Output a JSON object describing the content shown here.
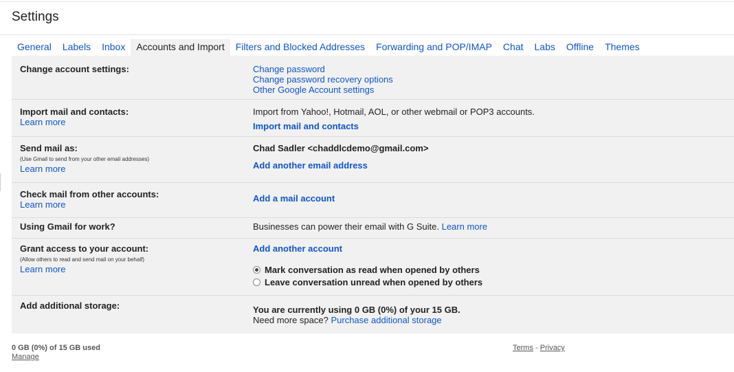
{
  "title": "Settings",
  "tabs": [
    {
      "label": "General"
    },
    {
      "label": "Labels"
    },
    {
      "label": "Inbox"
    },
    {
      "label": "Accounts and Import",
      "active": true
    },
    {
      "label": "Filters and Blocked Addresses"
    },
    {
      "label": "Forwarding and POP/IMAP"
    },
    {
      "label": "Chat"
    },
    {
      "label": "Labs"
    },
    {
      "label": "Offline"
    },
    {
      "label": "Themes"
    }
  ],
  "sections": {
    "change_account": {
      "label": "Change account settings:",
      "links": [
        "Change password",
        "Change password recovery options",
        "Other Google Account settings"
      ]
    },
    "import": {
      "label": "Import mail and contacts:",
      "learn_more": "Learn more",
      "description": "Import from Yahoo!, Hotmail, AOL, or other webmail or POP3 accounts.",
      "action": "Import mail and contacts"
    },
    "send_as": {
      "label": "Send mail as:",
      "sublabel": "(Use Gmail to send from your other email addresses)",
      "learn_more": "Learn more",
      "identity": "Chad Sadler <chaddlcdemo@gmail.com>",
      "action": "Add another email address"
    },
    "check_mail": {
      "label": "Check mail from other accounts:",
      "learn_more": "Learn more",
      "action": "Add a mail account"
    },
    "work": {
      "label": "Using Gmail for work?",
      "description": "Businesses can power their email with G Suite.",
      "learn_more": "Learn more"
    },
    "grant": {
      "label": "Grant access to your account:",
      "sublabel": "(Allow others to read and send mail on your behalf)",
      "learn_more": "Learn more",
      "action": "Add another account",
      "options": [
        {
          "label": "Mark conversation as read when opened by others",
          "checked": true
        },
        {
          "label": "Leave conversation unread when opened by others",
          "checked": false
        }
      ]
    },
    "storage": {
      "label": "Add additional storage:",
      "usage": "You are currently using 0 GB (0%) of your 15 GB.",
      "need_more": "Need more space?",
      "action": "Purchase additional storage"
    }
  },
  "footer": {
    "usage": "0 GB (0%) of 15 GB used",
    "manage": "Manage",
    "terms": "Terms",
    "separator": "-",
    "privacy": "Privacy"
  },
  "colors": {
    "link": "#1155cc",
    "panel_bg": "#f1f1f1",
    "text": "#222222"
  }
}
